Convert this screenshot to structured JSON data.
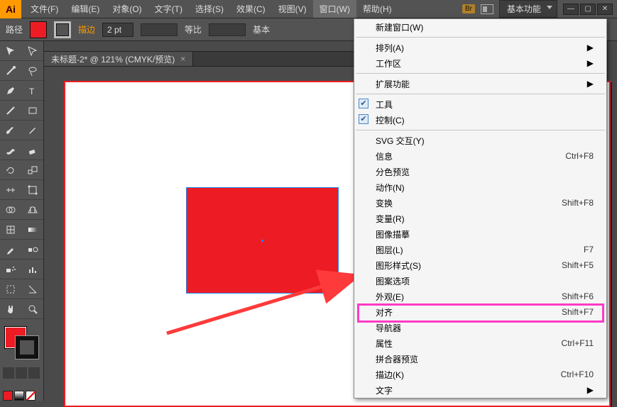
{
  "app_logo": "Ai",
  "menubar": {
    "file": "文件(F)",
    "edit": "编辑(E)",
    "object": "对象(O)",
    "type": "文字(T)",
    "select": "选择(S)",
    "effect": "效果(C)",
    "view": "视图(V)",
    "window": "窗口(W)",
    "help": "帮助(H)",
    "br_badge": "Br",
    "workspace": "基本功能"
  },
  "control": {
    "path_label": "路径",
    "stroke_label": "描边",
    "pt_value": "2 pt",
    "scale_label": "等比",
    "basic_truncated": "基本"
  },
  "doc_tab": {
    "title": "未标题-2* @ 121% (CMYK/预览)",
    "close": "×"
  },
  "window_menu": {
    "new_window": "新建窗口(W)",
    "arrange": "排列(A)",
    "workspace": "工作区",
    "extensions": "扩展功能",
    "tools": "工具",
    "control": "控制(C)",
    "svg_interact": "SVG 交互(Y)",
    "info": {
      "label": "信息",
      "shortcut": "Ctrl+F8"
    },
    "sep_preview": "分色预览",
    "actions": "动作(N)",
    "transform": {
      "label": "变换",
      "shortcut": "Shift+F8"
    },
    "variables": "变量(R)",
    "image_trace": "图像描摹",
    "layers": {
      "label": "图层(L)",
      "shortcut": "F7"
    },
    "graphic_styles": {
      "label": "图形样式(S)",
      "shortcut": "Shift+F5"
    },
    "pattern_options": "图案选项",
    "appearance": {
      "label": "外观(E)",
      "shortcut": "Shift+F6"
    },
    "align": {
      "label": "对齐",
      "shortcut": "Shift+F7"
    },
    "navigator": "导航器",
    "attributes": {
      "label": "属性",
      "shortcut": "Ctrl+F11"
    },
    "flattener": "拼合器预览",
    "stroke": {
      "label": "描边(K)",
      "shortcut": "Ctrl+F10"
    },
    "type": "文字"
  }
}
